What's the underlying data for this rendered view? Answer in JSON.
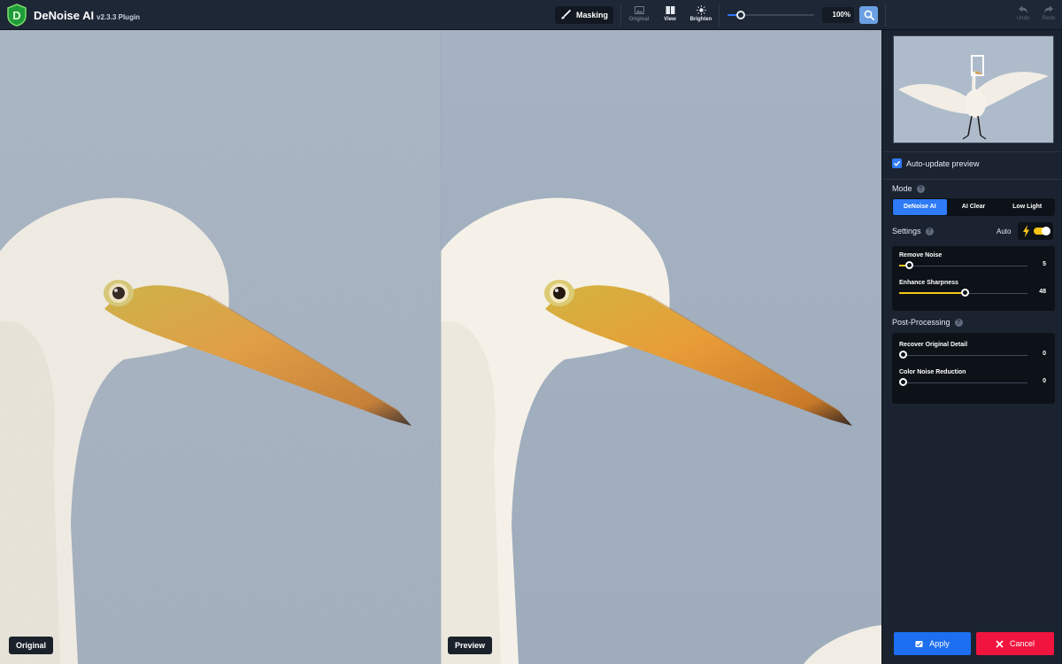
{
  "app": {
    "name": "DeNoise AI",
    "version": "v2.3.3 Plugin",
    "logo_letter": "D"
  },
  "toolbar": {
    "masking_label": "Masking",
    "view_tools": [
      {
        "label": "Original",
        "icon": "image-icon",
        "state": "disabled"
      },
      {
        "label": "View",
        "icon": "split-view-icon",
        "state": "enabled"
      },
      {
        "label": "Brighten",
        "icon": "sun-icon",
        "state": "enabled"
      }
    ],
    "zoom_value": "100%",
    "zoom_slider_fraction": 0.15,
    "undo_label": "Undo",
    "redo_label": "Redo"
  },
  "panels": {
    "left_label": "Original",
    "right_label": "Preview"
  },
  "sidebar": {
    "auto_update_label": "Auto-update preview",
    "auto_update_checked": true,
    "mode": {
      "title": "Mode",
      "options": [
        "DeNoise AI",
        "AI Clear",
        "Low Light"
      ],
      "selected": "DeNoise AI"
    },
    "settings": {
      "title": "Settings",
      "auto_label": "Auto",
      "auto_on": true,
      "sliders": [
        {
          "label": "Remove Noise",
          "value": "5",
          "fraction": 0.05
        },
        {
          "label": "Enhance Sharpness",
          "value": "48",
          "fraction": 0.48
        }
      ]
    },
    "post": {
      "title": "Post-Processing",
      "sliders": [
        {
          "label": "Recover Original Detail",
          "value": "0",
          "fraction": 0.0
        },
        {
          "label": "Color Noise Reduction",
          "value": "0",
          "fraction": 0.0
        }
      ]
    },
    "apply_label": "Apply",
    "cancel_label": "Cancel"
  },
  "colors": {
    "accent_blue": "#2f7bf5",
    "slider_yellow": "#f5c518",
    "cancel_red": "#f0143f",
    "sky": "#a3b1c1"
  }
}
